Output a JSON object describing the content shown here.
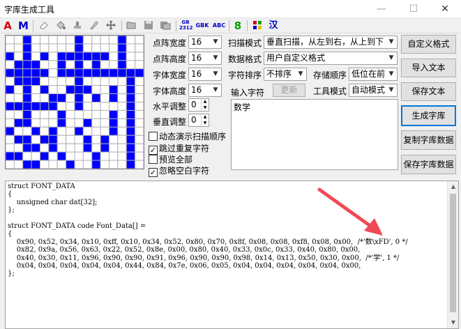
{
  "window": {
    "title": "字库生成工具",
    "minimize": "—",
    "maximize": "☐",
    "close": "✕"
  },
  "toolbar": {
    "bold_a": "A",
    "bold_m": "M",
    "gb2312_top": "GB",
    "gb2312_bottom": "2312",
    "gbk": "GBK",
    "abc": "ABC",
    "digit8": "8",
    "han": "汉",
    "accent_red": "#d40000",
    "accent_blue": "#0000c8",
    "accent_green": "#00a000"
  },
  "glyph_grid": {
    "rows": [
      "..X.....X....X..",
      "..X.....X....X..",
      "X.X.X.XXXXXX.X..",
      ".XXX..X.X.X..X..",
      "XXXXX.XXXXXXXXXX",
      ".XXX....X.....X.",
      "X.X.X..XXX..X.X.",
      "..X..XX.X.X.X.X.",
      "XXXXXX..X.....X.",
      "..X...X.....X.X.",
      ".XX...X..X..X.X.",
      "X..X.X..X...X.X.",
      ".XX.XX...X.X..X.",
      "..XX.X...X.X..X.",
      "XX..X.X...X...X.",
      "..XX...X..X...X."
    ],
    "on_color": "#0000ff",
    "off_color": "#ffffff",
    "line_color": "#b0b0b0"
  },
  "settings": {
    "dot_width_label": "点阵宽度",
    "dot_width_value": "16",
    "dot_height_label": "点阵高度",
    "dot_height_value": "16",
    "font_width_label": "字体宽度",
    "font_width_value": "16",
    "font_height_label": "字体高度",
    "font_height_value": "16",
    "h_adjust_label": "水平调整",
    "h_adjust_value": "0",
    "v_adjust_label": "垂直调整",
    "v_adjust_value": "0"
  },
  "checkboxes": [
    {
      "label": "动态演示扫描顺序",
      "checked": false
    },
    {
      "label": "跳过重复字符",
      "checked": true
    },
    {
      "label": "预览全部",
      "checked": false
    },
    {
      "label": "忽略空白字符",
      "checked": true
    }
  ],
  "scan": {
    "scan_mode_label": "扫描模式",
    "scan_mode_value": "垂直扫描，从左到右，从上到下",
    "data_format_label": "数据格式",
    "data_format_value": "用户自定义格式",
    "char_order_label": "字符排序",
    "char_order_value": "不排序",
    "store_order_label": "存储顺序",
    "store_order_value": "低位在前",
    "input_char_label": "输入字符",
    "refresh_button": "更新",
    "tool_mode_label": "工具模式",
    "tool_mode_value": "自动模式",
    "input_text": "数学"
  },
  "buttons": {
    "custom_format": "自定义格式",
    "import_text": "导入文本",
    "save_text": "保存文本",
    "generate": "生成字库",
    "copy_data": "复制字库数据",
    "save_data": "保存字库数据"
  },
  "code": {
    "text": "struct FONT_DATA\n{\n    unsigned char dat[32];\n};\n\nstruct FONT_DATA code Font_Data[] =\n{\n    0x90, 0x52, 0x34, 0x10, 0xff, 0x10, 0x34, 0x52, 0x80, 0x70, 0x8f, 0x08, 0x08, 0xf8, 0x08, 0x00,  /*'数\\xFD', 0 */\n    0x82, 0x9a, 0x56, 0x63, 0x22, 0x52, 0x8e, 0x00, 0x80, 0x40, 0x33, 0x0c, 0x33, 0x40, 0x80, 0x00,\n    0x40, 0x30, 0x11, 0x96, 0x90, 0x90, 0x91, 0x96, 0x90, 0x90, 0x98, 0x14, 0x13, 0x50, 0x30, 0x00,  /*'学', 1 */\n    0x04, 0x04, 0x04, 0x04, 0x04, 0x44, 0x84, 0x7e, 0x06, 0x05, 0x04, 0x04, 0x04, 0x04, 0x04, 0x00,\n};"
  },
  "annotation": {
    "arrow_color": "#f04a55"
  }
}
